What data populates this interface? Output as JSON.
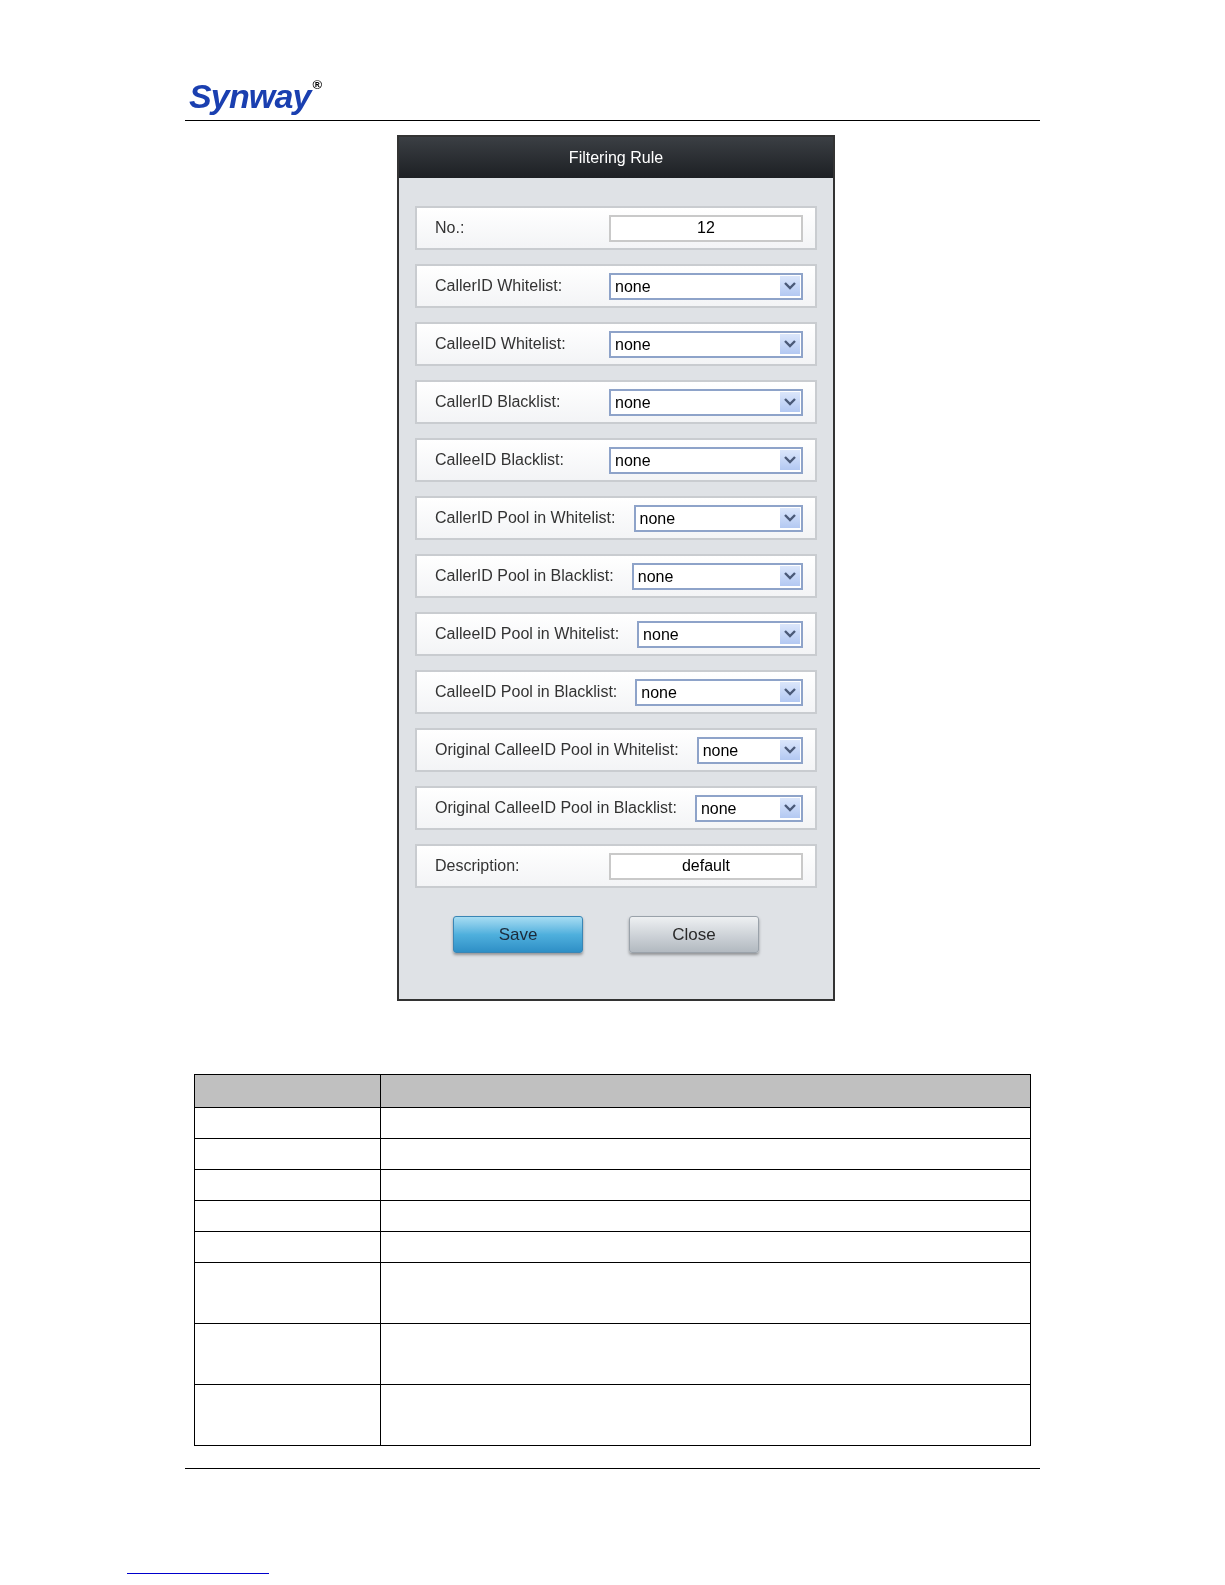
{
  "header": {
    "logo": "Synway",
    "registered_mark": "®"
  },
  "dialog": {
    "title": "Filtering Rule",
    "fields": [
      {
        "kind": "text",
        "label": "No.:",
        "value": "12"
      },
      {
        "kind": "select",
        "label": "CallerID Whitelist:",
        "value": "none"
      },
      {
        "kind": "select",
        "label": "CalleeID Whitelist:",
        "value": "none"
      },
      {
        "kind": "select",
        "label": "CallerID Blacklist:",
        "value": "none"
      },
      {
        "kind": "select",
        "label": "CalleeID Blacklist:",
        "value": "none"
      },
      {
        "kind": "select",
        "label": "CallerID Pool in Whitelist:",
        "value": "none"
      },
      {
        "kind": "select",
        "label": "CallerID Pool in Blacklist:",
        "value": "none"
      },
      {
        "kind": "select",
        "label": "CalleeID Pool in Whitelist:",
        "value": "none"
      },
      {
        "kind": "select",
        "label": "CalleeID Pool in Blacklist:",
        "value": "none"
      },
      {
        "kind": "select",
        "label": "Original CalleeID Pool in Whitelist:",
        "value": "none"
      },
      {
        "kind": "select",
        "label": "Original CalleeID Pool in Blacklist:",
        "value": "none"
      },
      {
        "kind": "text",
        "label": "Description:",
        "value": "default"
      }
    ],
    "buttons": [
      {
        "kind": "primary",
        "label": "Save"
      },
      {
        "kind": "secondary",
        "label": "Close"
      }
    ]
  }
}
